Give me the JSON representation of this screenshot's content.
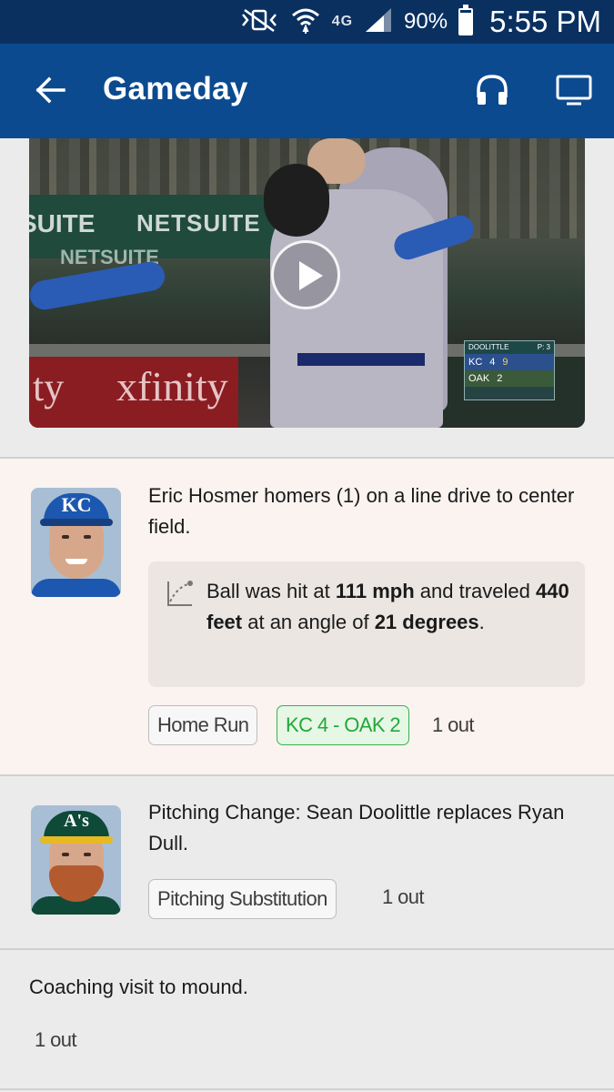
{
  "status_bar": {
    "battery_percent": "90%",
    "battery_level": 0.9,
    "network": "4G",
    "time": "5:55 PM",
    "icons": [
      "vibrate-mute-icon",
      "wifi-icon",
      "4g-lte-icon",
      "cell-signal-icon",
      "battery-icon"
    ]
  },
  "app_bar": {
    "title": "Gameday",
    "icons": [
      "back-arrow-icon",
      "headphones-icon",
      "tv-icon"
    ]
  },
  "video": {
    "banner_left": "SUITE",
    "banner_mid": "NETSUITE",
    "banner_lower": "NETSUITE",
    "ad_board": "xfinity",
    "ad_board_left": "ty",
    "scorebug": {
      "header_left": "DOOLITTLE",
      "header_right": "P: 3",
      "team1": "KC",
      "score1": "4",
      "inning": "9",
      "team2": "OAK",
      "score2": "2"
    }
  },
  "feed": [
    {
      "description": "Eric Hosmer homers (1) on a line drive to center field.",
      "statcast": {
        "prefix": "Ball was hit at ",
        "speed": "111 mph",
        "mid": " and traveled ",
        "distance": "440 feet",
        "mid2": " at an angle of ",
        "angle": "21 degrees",
        "suffix": "."
      },
      "tags": [
        "Home Run",
        "KC 4 - OAK 2"
      ],
      "outs": "1 out",
      "avatar_team": "KC"
    },
    {
      "description": "Pitching Change: Sean Doolittle replaces Ryan Dull.",
      "tags": [
        "Pitching Substitution"
      ],
      "outs": "1 out",
      "avatar_team": "A's"
    },
    {
      "description": "Coaching visit to mound.",
      "outs": "1 out"
    }
  ],
  "colors": {
    "status_bar": "#0a3060",
    "app_bar": "#0b4a8f",
    "score_chip_green": "#22a83a",
    "highlight_card": "#faf3ef"
  }
}
